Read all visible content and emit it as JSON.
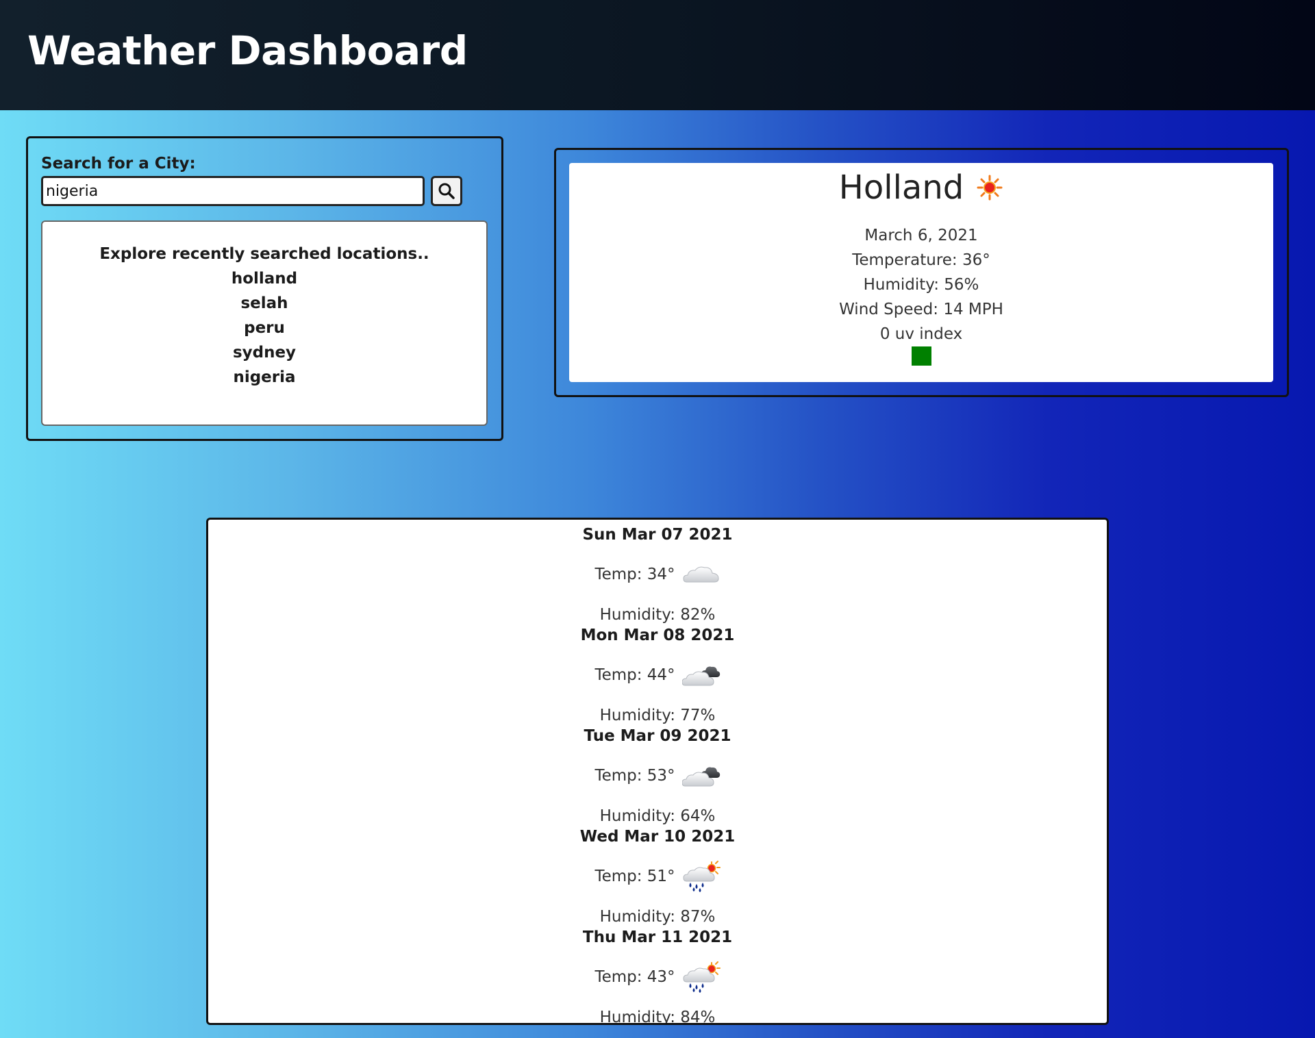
{
  "header": {
    "title": "Weather Dashboard"
  },
  "search": {
    "label": "Search for a City:",
    "value": "nigeria",
    "button_icon": "search-icon"
  },
  "recent": {
    "title": "Explore recently searched locations..",
    "items": [
      "holland",
      "selah",
      "peru",
      "sydney",
      "nigeria"
    ]
  },
  "current": {
    "city": "Holland",
    "icon": "sun-icon",
    "date": "March 6, 2021",
    "temperature": "Temperature: 36°",
    "humidity": "Humidity: 56%",
    "wind": "Wind Speed: 14 MPH",
    "uv": "0 uv index",
    "uv_color": "#008000"
  },
  "forecast": [
    {
      "date": "Sun Mar 07 2021",
      "temp": "Temp: 34°",
      "humidity": "Humidity: 82%",
      "icon": "cloud-icon"
    },
    {
      "date": "Mon Mar 08 2021",
      "temp": "Temp: 44°",
      "humidity": "Humidity: 77%",
      "icon": "overcast-icon"
    },
    {
      "date": "Tue Mar 09 2021",
      "temp": "Temp: 53°",
      "humidity": "Humidity: 64%",
      "icon": "overcast-icon"
    },
    {
      "date": "Wed Mar 10 2021",
      "temp": "Temp: 51°",
      "humidity": "Humidity: 87%",
      "icon": "rain-sun-icon"
    },
    {
      "date": "Thu Mar 11 2021",
      "temp": "Temp: 43°",
      "humidity": "Humidity: 84%",
      "icon": "rain-sun-icon"
    }
  ]
}
